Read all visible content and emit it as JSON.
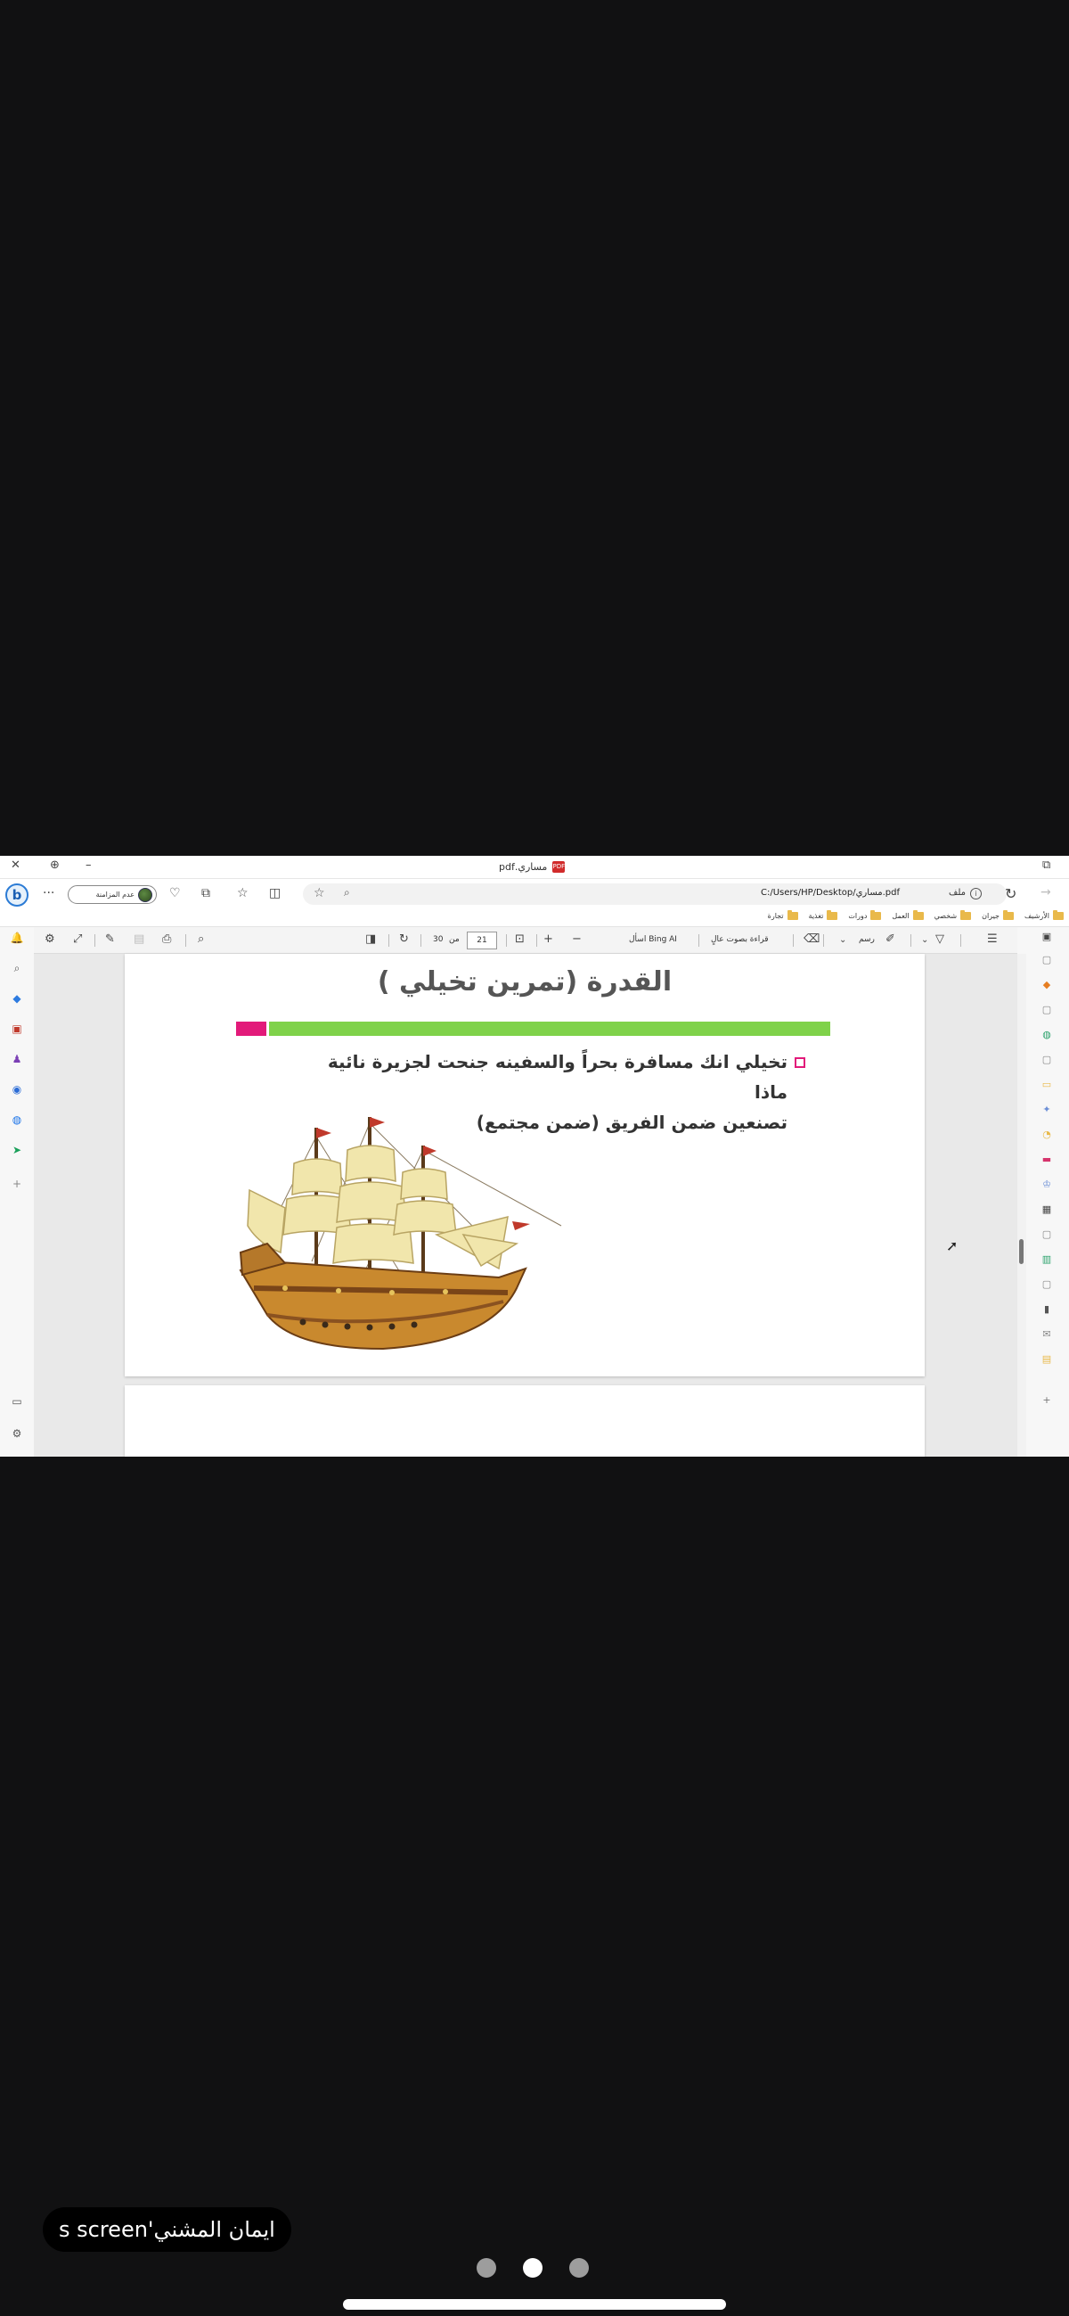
{
  "window": {
    "tab_title": "مساري.pdf",
    "close_glyph": "✕",
    "pin_glyph": "⊕",
    "minimize_glyph": "–"
  },
  "address_bar": {
    "url": "C:/Users/HP/Desktop/مساري.pdf",
    "file_label": "ملف",
    "profile_label": "عدم المزامنة"
  },
  "favorites": [
    {
      "label": "الأرشيف"
    },
    {
      "label": "جيران"
    },
    {
      "label": "شخصي"
    },
    {
      "label": "العمل"
    },
    {
      "label": "دورات"
    },
    {
      "label": "تغذية"
    },
    {
      "label": "تجارة"
    }
  ],
  "pdf_toolbar": {
    "draw_label": "رسم",
    "read_aloud_label": "قراءة بصوت عالٍ",
    "ask_bing_label": "اسأل Bing AI",
    "page_current": "21",
    "page_of": "من",
    "page_total": "30",
    "zoom_out": "−",
    "zoom_in": "+"
  },
  "document": {
    "title": "القدرة (تمرين تخيلي )",
    "body_line1": "تخيلي انك مسافرة بحراً والسفينه جنحت لجزيرة نائية ماذا",
    "body_line2": "تصنعين ضمن الفريق (ضمن مجتمع)",
    "colors": {
      "green_bar": "#7fd24a",
      "pink_accent": "#e21a7a"
    }
  },
  "overlay": {
    "screen_owner": "s screen'ايمان المشني",
    "carousel_pages": 3,
    "carousel_active": 2
  }
}
